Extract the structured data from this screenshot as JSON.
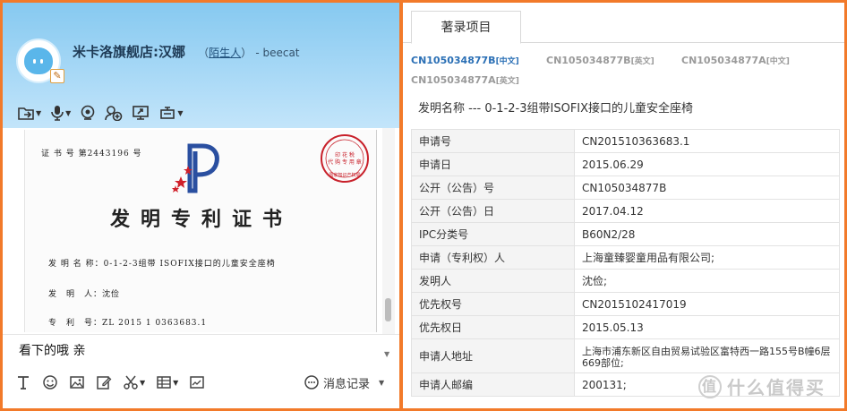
{
  "chat": {
    "contact_name": "米卡洛旗舰店:汉娜",
    "tag_open": "（",
    "tag_label": "陌生人",
    "tag_close": "）",
    "contact_sub": "- beecat",
    "certificate": {
      "number": "证 书 号 第2443196 号",
      "title": "发明专利证书",
      "invention_name": "发 明 名 称：0-1-2-3组带 ISOFIX接口的儿童安全座椅",
      "inventor": "发　明　人：沈俭",
      "patent_no": "专　利　号：ZL 2015 1 0363683.1",
      "stamp_text": "国家知识产权局"
    },
    "message": "看下的哦 亲",
    "history_label": "消息记录",
    "collapse_icon": "triangle-down"
  },
  "record": {
    "tab_label": "著录项目",
    "doc_links": [
      {
        "code": "CN105034877B",
        "lang": "[中文]",
        "active": true
      },
      {
        "code": "CN105034877B",
        "lang": "[英文]",
        "active": false
      },
      {
        "code": "CN105034877A",
        "lang": "[中文]",
        "active": false
      },
      {
        "code": "CN105034877A",
        "lang": "[英文]",
        "active": false
      }
    ],
    "invention_line": "发明名称 ---  0-1-2-3组带ISOFIX接口的儿童安全座椅",
    "rows": [
      {
        "key": "申请号",
        "value": "CN201510363683.1"
      },
      {
        "key": "申请日",
        "value": "2015.06.29"
      },
      {
        "key": "公开（公告）号",
        "value": "CN105034877B"
      },
      {
        "key": "公开（公告）日",
        "value": "2017.04.12"
      },
      {
        "key": "IPC分类号",
        "value": "B60N2/28"
      },
      {
        "key": "申请（专利权）人",
        "value": "上海童臻婴童用品有限公司;"
      },
      {
        "key": "发明人",
        "value": "沈俭;"
      },
      {
        "key": "优先权号",
        "value": "CN2015102417019"
      },
      {
        "key": "优先权日",
        "value": "2015.05.13"
      },
      {
        "key": "申请人地址",
        "value": "上海市浦东新区自由贸易试验区富特西一路155号B幢6层669部位;"
      },
      {
        "key": "申请人邮编",
        "value": "200131;"
      }
    ],
    "watermark": "什么值得买",
    "watermark_badge": "值"
  },
  "colors": {
    "frame": "#f27a2a",
    "header_blue": "#86c9f0",
    "active_link": "#2a6fb5",
    "stamp_red": "#c8202a"
  }
}
